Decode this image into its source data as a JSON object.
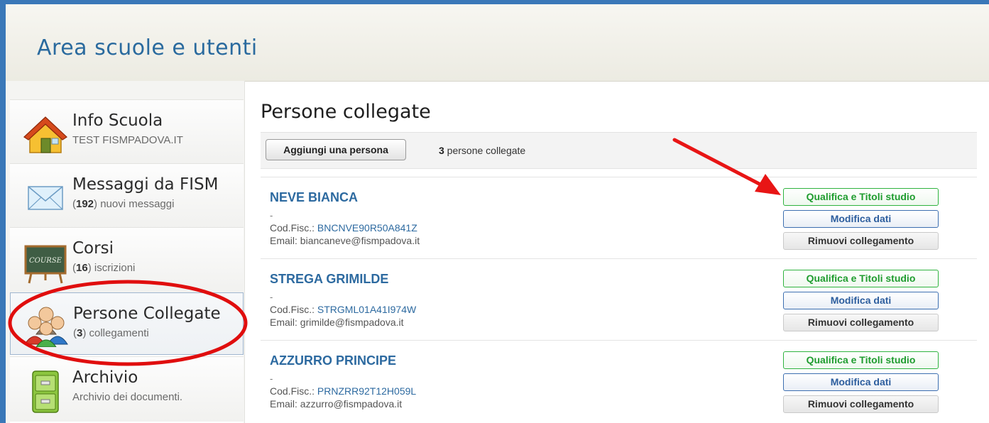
{
  "header": {
    "title": "Area scuole e utenti"
  },
  "sidebar": {
    "items": [
      {
        "title": "Info Scuola",
        "sub_text": "TEST FISMPADOVA.IT",
        "icon": "house-icon"
      },
      {
        "title": "Messaggi da FISM",
        "count": "192",
        "sub_text": " nuovi messaggi",
        "icon": "envelope-icon"
      },
      {
        "title": "Corsi",
        "count": "16",
        "sub_text": " iscrizioni",
        "icon": "course-board-icon",
        "board_text": "COURSE"
      },
      {
        "title": "Persone Collegate",
        "count": "3",
        "sub_text": " collegamenti",
        "icon": "people-icon"
      },
      {
        "title": "Archivio",
        "sub_text": "Archivio dei documenti.",
        "icon": "file-cabinet-icon"
      }
    ]
  },
  "main": {
    "title": "Persone collegate",
    "add_button": "Aggiungi una persona",
    "count": "3",
    "count_text": " persone collegate",
    "cf_label": "Cod.Fisc.: ",
    "email_label": "Email: ",
    "dash": "-",
    "buttons": {
      "qualifica": "Qualifica e Titoli studio",
      "modifica": "Modifica dati",
      "rimuovi": "Rimuovi collegamento"
    },
    "persons": [
      {
        "name": "NEVE BIANCA",
        "cf": "BNCNVE90R50A841Z",
        "email": "biancaneve@fismpadova.it"
      },
      {
        "name": "STREGA GRIMILDE",
        "cf": "STRGML01A41I974W",
        "email": "grimilde@fismpadova.it"
      },
      {
        "name": "AZZURRO PRINCIPE",
        "cf": "PRNZRR92T12H059L",
        "email": "azzurro@fismpadova.it"
      }
    ]
  },
  "annotation": {
    "arrow_color": "#e81515",
    "ellipse_color": "#e00e0e"
  }
}
